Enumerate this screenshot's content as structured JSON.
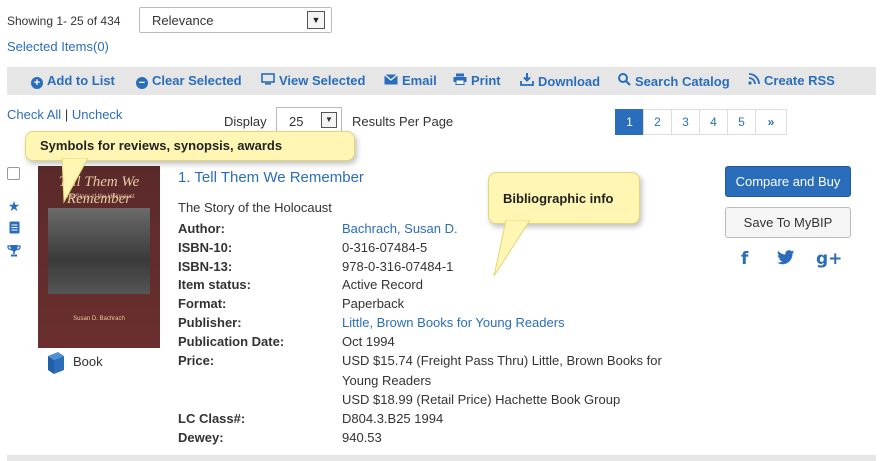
{
  "header": {
    "showing": "Showing 1- 25 of 434",
    "sort_value": "Relevance",
    "selected_items": "Selected Items(0)"
  },
  "toolbar": {
    "items": [
      {
        "label": "Add to List",
        "icon": "plus-circle-icon"
      },
      {
        "label": "Clear Selected",
        "icon": "minus-circle-icon"
      },
      {
        "label": "View Selected",
        "icon": "monitor-icon"
      },
      {
        "label": "Email",
        "icon": "envelope-icon"
      },
      {
        "label": "Print",
        "icon": "printer-icon"
      },
      {
        "label": "Download",
        "icon": "download-icon"
      },
      {
        "label": "Search Catalog",
        "icon": "search-icon"
      },
      {
        "label": "Create RSS",
        "icon": "rss-icon"
      }
    ]
  },
  "controls": {
    "check_all": "Check All",
    "separator": "|",
    "uncheck": "Uncheck",
    "display_label": "Display",
    "per_page_value": "25",
    "results_per_page": "Results Per Page"
  },
  "pagination": {
    "pages": [
      "1",
      "2",
      "3",
      "4",
      "5"
    ],
    "active": "1",
    "next": "»"
  },
  "callouts": {
    "symbols": "Symbols for reviews, synopsis, awards",
    "biblio": "Bibliographic info"
  },
  "result": {
    "title": "1. Tell Them We Remember",
    "subtitle": "The Story of the Holocaust",
    "cover_title": "Tell Them We Remember",
    "cover_subtitle": "The Story of the Holocaust",
    "cover_author": "Susan D. Bachrach",
    "format_label": "Book",
    "fields": {
      "author_label": "Author:",
      "author": "Bachrach, Susan D.",
      "isbn10_label": "ISBN-10:",
      "isbn10": "0-316-07484-5",
      "isbn13_label": "ISBN-13:",
      "isbn13": "978-0-316-07484-1",
      "status_label": "Item status:",
      "status": "Active Record",
      "format_label": "Format:",
      "format": "Paperback",
      "publisher_label": "Publisher:",
      "publisher": "Little, Brown Books for Young Readers",
      "pubdate_label": "Publication Date:",
      "pubdate": "Oct 1994",
      "price_label": "Price:",
      "price_line1": "USD $15.74 (Freight Pass Thru) Little, Brown Books for",
      "price_line2": "Young Readers",
      "price_line3": "USD $18.99 (Retail Price) Hachette Book Group",
      "lc_label": "LC Class#:",
      "lc": "D804.3.B25 1994",
      "dewey_label": "Dewey:",
      "dewey": "940.53"
    },
    "compare_button": "Compare and Buy",
    "save_button": "Save To MyBIP",
    "social": {
      "facebook": "f",
      "google": "g+"
    }
  },
  "colors": {
    "link": "#2a6ebb",
    "toolbar_bg": "#e6e6e6",
    "callout_bg": "#fff6b3",
    "active_page": "#2a6ebb"
  }
}
